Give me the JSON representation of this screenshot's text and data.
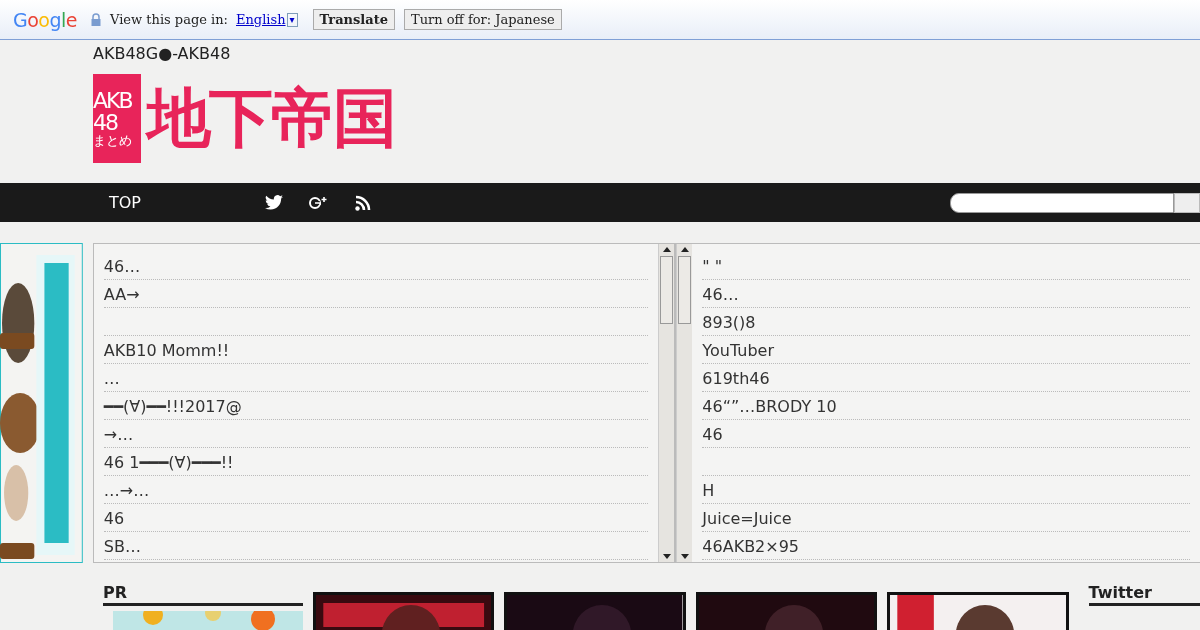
{
  "translate_bar": {
    "brand": "Google",
    "prompt": "View this page in:",
    "language": "English",
    "dropdown": "▾",
    "buttons": [
      "Translate",
      "Turn off for: Japanese"
    ]
  },
  "header": {
    "tagline": "AKB48G●-AKB48",
    "logo_badge": [
      "AKB",
      "48",
      "まとめ"
    ],
    "logo_title": "地下帝国"
  },
  "nav": {
    "items": [
      "TOP"
    ]
  },
  "left_list": {
    "rows": [
      "46…",
      "AA→",
      null,
      "AKB10 Momm!!",
      "…",
      "━━(∀)━━!!!2017@",
      "→…",
      "46 1━━━(∀)━━━!!",
      " …→…",
      "46",
      "SB…"
    ]
  },
  "right_list": {
    "rows": [
      "\" \"",
      "46…",
      "893()8",
      "YouTuber",
      "619th46",
      "46“”…BRODY 10",
      "46",
      null,
      "H",
      "Juice=Juice",
      "46AKB2×95"
    ]
  },
  "bottom": {
    "pr_heading": "PR",
    "twitter_heading": "Twitter"
  }
}
